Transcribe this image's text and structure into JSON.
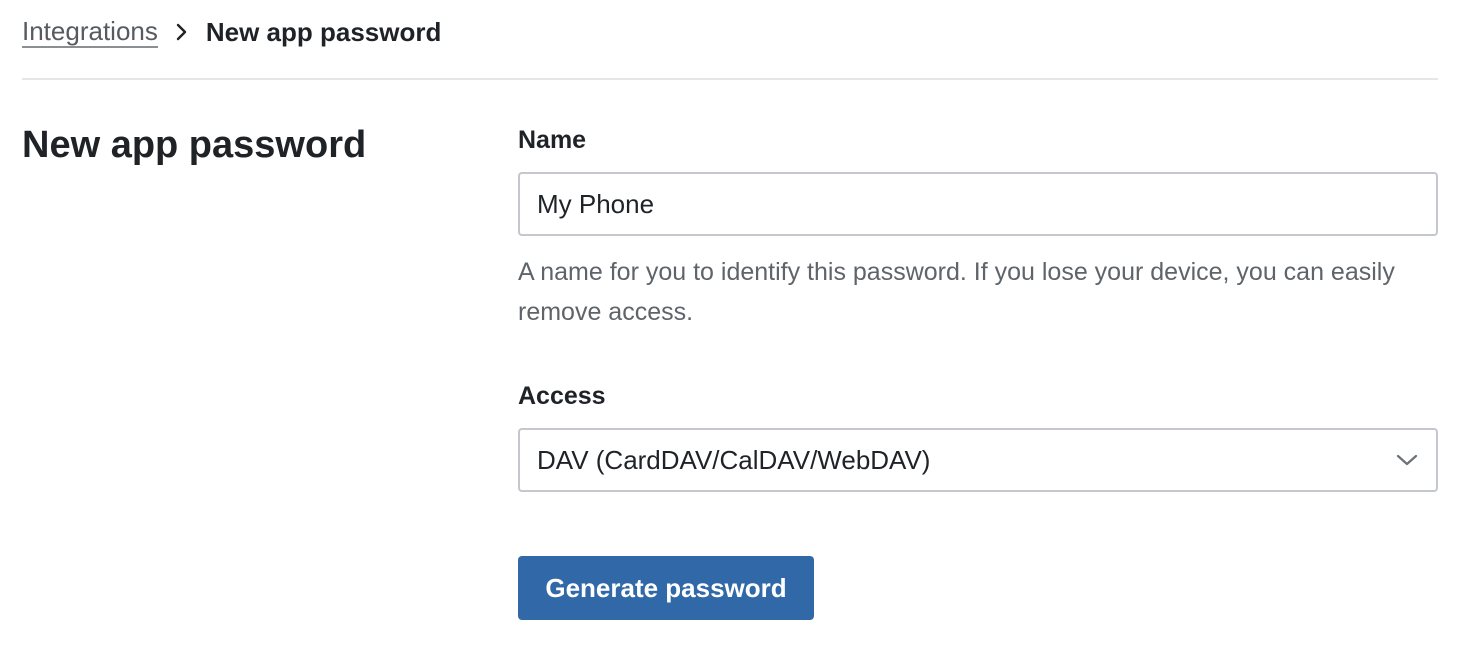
{
  "breadcrumb": {
    "parent_label": "Integrations",
    "current_label": "New app password"
  },
  "section": {
    "title": "New app password"
  },
  "form": {
    "name_label": "Name",
    "name_value": "My Phone",
    "name_help": "A name for you to identify this password. If you lose your device, you can easily remove access.",
    "access_label": "Access",
    "access_selected": "DAV (CardDAV/CalDAV/WebDAV)",
    "submit_label": "Generate password"
  },
  "icons": {
    "breadcrumb_separator": "chevron-right-icon",
    "select_dropdown": "chevron-down-icon"
  },
  "colors": {
    "primary_button": "#3168a8",
    "help_text": "#5e6469",
    "border": "#c4c8cc"
  }
}
